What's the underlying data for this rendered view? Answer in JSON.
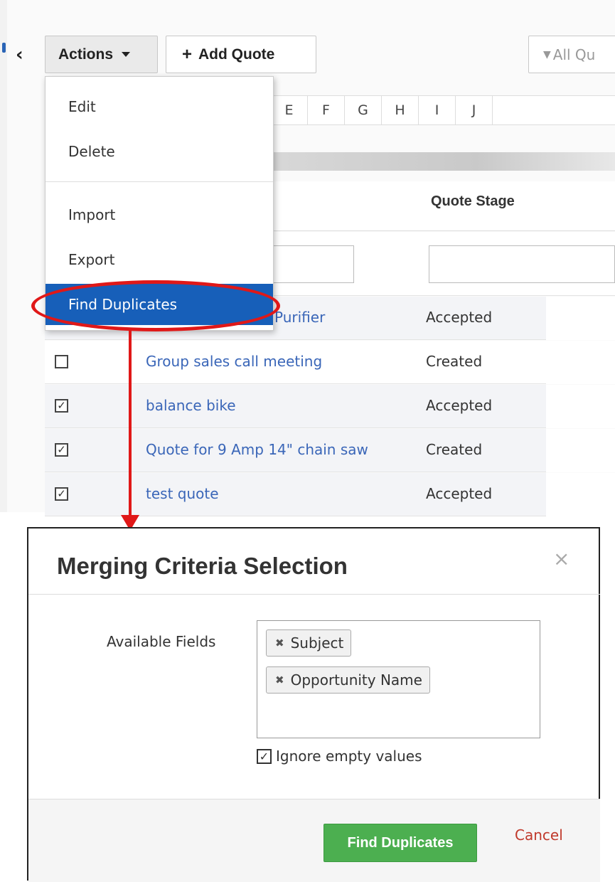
{
  "toolbar": {
    "actions_label": "Actions",
    "add_quote_label": "Add Quote",
    "filter_label": "All Qu"
  },
  "alphabet": [
    "E",
    "F",
    "G",
    "H",
    "I",
    "J"
  ],
  "table": {
    "stage_header": "Quote Stage",
    "rows": [
      {
        "subject": "Purifier",
        "stage": "Accepted",
        "checked": false,
        "show_checkbox": false
      },
      {
        "subject": "Group sales call meeting",
        "stage": "Created",
        "checked": false,
        "show_checkbox": true
      },
      {
        "subject": "balance bike",
        "stage": "Accepted",
        "checked": true,
        "show_checkbox": true
      },
      {
        "subject": "Quote for 9 Amp 14\" chain saw",
        "stage": "Created",
        "checked": true,
        "show_checkbox": true
      },
      {
        "subject": "test quote",
        "stage": "Accepted",
        "checked": true,
        "show_checkbox": true
      }
    ]
  },
  "actions_menu": {
    "items": [
      "Edit",
      "Delete",
      "Import",
      "Export",
      "Find Duplicates"
    ],
    "highlighted": "Find Duplicates"
  },
  "modal": {
    "title": "Merging Criteria Selection",
    "close_symbol": "×",
    "available_fields_label": "Available Fields",
    "selected_fields": [
      "Subject",
      "Opportunity Name"
    ],
    "ignore_empty_label": "Ignore empty values",
    "ignore_empty_checked": true,
    "find_button": "Find Duplicates",
    "cancel_link": "Cancel"
  },
  "colors": {
    "highlight_blue": "#175fb9",
    "annotation_red": "#e01818",
    "button_green": "#4caf50",
    "link_blue": "#3a66b8"
  }
}
